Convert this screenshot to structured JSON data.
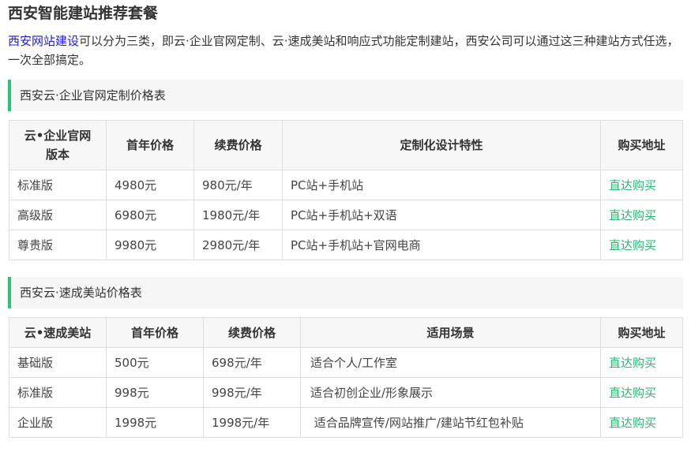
{
  "page": {
    "title": "西安智能建站推荐套餐",
    "intro_link": "西安网站建设",
    "intro_text": "可以分为三类，即云·企业官网定制、云·速成美站和响应式功能定制建站，西安公司可以通过这三种建站方式任选，一次全部搞定。"
  },
  "colors": {
    "accent_green": "#2ec17c",
    "link_blue": "#1a1ae0",
    "buy_link_green": "#2ab872"
  },
  "section1": {
    "heading": "西安云·企业官网定制价格表",
    "headers": [
      "云•企业官网版本",
      "首年价格",
      "续费价格",
      "定制化设计特性",
      "购买地址"
    ],
    "rows": [
      [
        "标准版",
        "4980元",
        "980元/年",
        "PC站+手机站",
        "直达购买"
      ],
      [
        "高级版",
        "6980元",
        "1980元/年",
        "PC站+手机站+双语",
        "直达购买"
      ],
      [
        "尊贵版",
        "9980元",
        "2980元/年",
        "PC站+手机站+官网电商",
        "直达购买"
      ]
    ]
  },
  "section2": {
    "heading": "西安云·速成美站价格表",
    "headers": [
      "云•速成美站",
      "首年价格",
      "续费价格",
      "适用场景",
      "购买地址"
    ],
    "rows": [
      [
        "基础版",
        "500元",
        "698元/年",
        "适合个人/工作室",
        "直达购买"
      ],
      [
        "标准版",
        "998元",
        "998元/年",
        "适合初创企业/形象展示",
        "直达购买"
      ],
      [
        "企业版",
        "1998元",
        "1998元/年",
        " 适合品牌宣传/网站推广/建站节红包补贴",
        "直达购买"
      ]
    ]
  }
}
